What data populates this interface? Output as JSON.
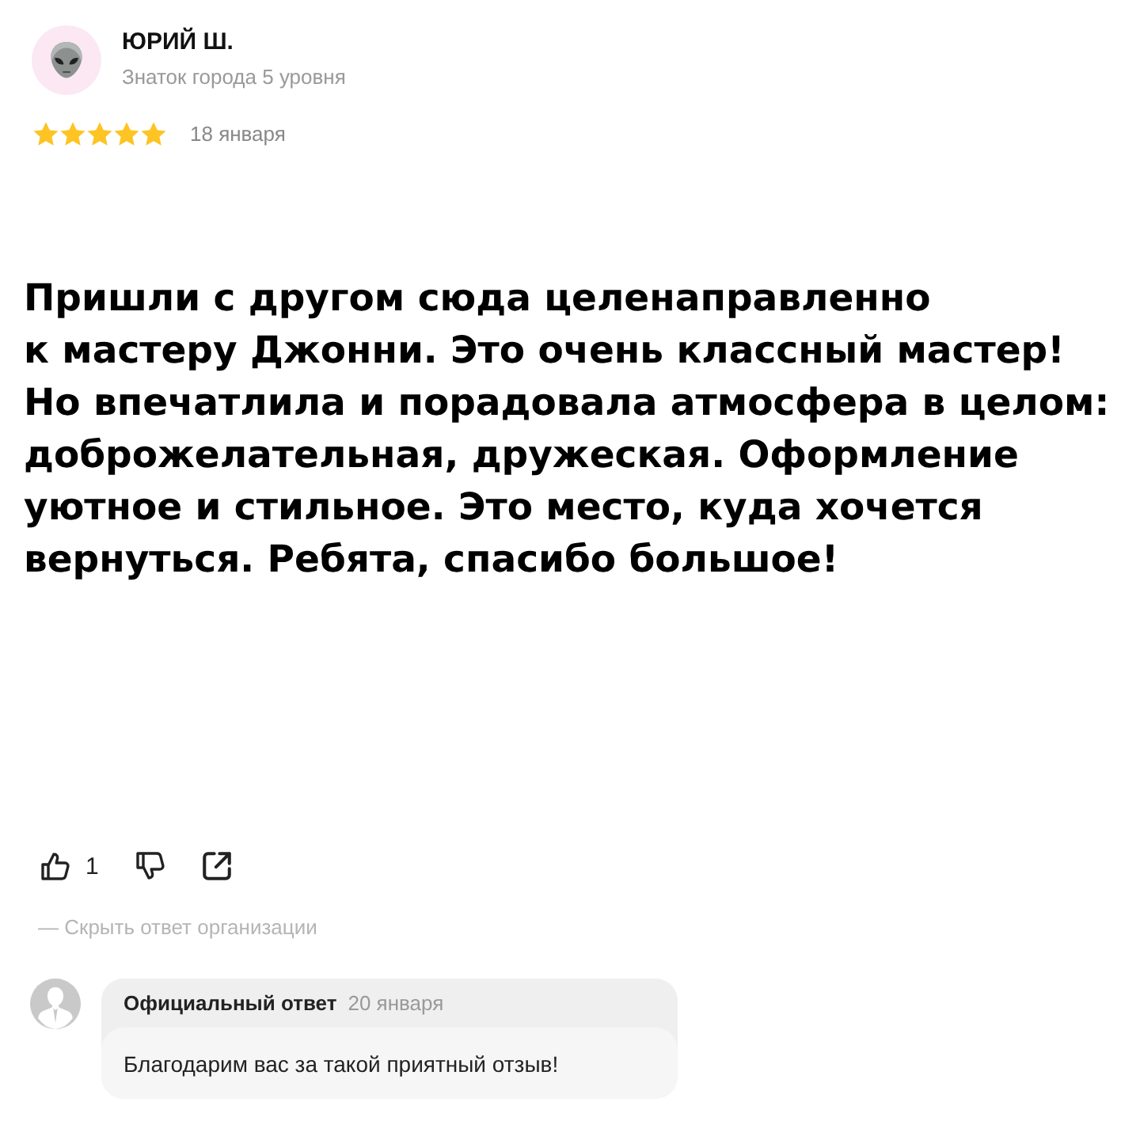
{
  "author": {
    "name": "ЮРИЙ Ш.",
    "level": "Знаток города 5 уровня"
  },
  "review": {
    "stars": 5,
    "date": "18 января",
    "text": "Пришли с другом сюда целенаправленно к мастеру Джонни. Это очень классный мастер! Но впечатлила и порадовала атмосфера в целом: доброжелательная, дружеская. Оформление уютное и стильное. Это место, куда хочется вернуться. Ребята, спасибо большое!"
  },
  "actions": {
    "likes": "1"
  },
  "reply_toggle": {
    "label": "— Скрыть ответ организации"
  },
  "reply": {
    "title": "Официальный ответ",
    "date": "20 января",
    "text": "Благодарим вас за такой приятный отзыв!"
  }
}
